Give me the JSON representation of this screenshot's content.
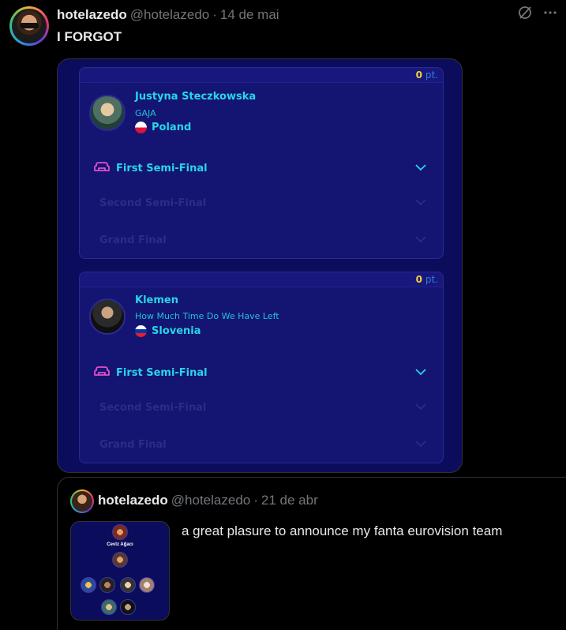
{
  "tweet": {
    "display_name": "hotelazedo",
    "handle": "@hotelazedo",
    "separator": "·",
    "date": "14 de mai",
    "text": "I FORGOT"
  },
  "icons": {
    "grok": "grok-icon",
    "more": "more-icon"
  },
  "cards": [
    {
      "points_value": "0",
      "points_unit": "pt.",
      "artist": "Justyna Steczkowska",
      "song": "GAJA",
      "country": "Poland",
      "stages": {
        "first": "First Semi-Final",
        "second": "Second Semi-Final",
        "final": "Grand Final"
      }
    },
    {
      "points_value": "0",
      "points_unit": "pt.",
      "artist": "Klemen",
      "song": "How Much Time Do We Have Left",
      "country": "Slovenia",
      "stages": {
        "first": "First Semi-Final",
        "second": "Second Semi-Final",
        "final": "Grand Final"
      }
    }
  ],
  "quoted": {
    "display_name": "hotelazedo",
    "handle": "@hotelazedo",
    "separator": "·",
    "date": "21 de abr",
    "text": "a great plasure to announce my fanta eurovision team",
    "thumb_caption": "Cevlz Ağacı"
  },
  "colors": {
    "accent_cyan": "#26d6e8",
    "card_bg": "#141472",
    "points_yellow": "#f2d33b",
    "stage_icon_pink": "#e54ec9"
  }
}
